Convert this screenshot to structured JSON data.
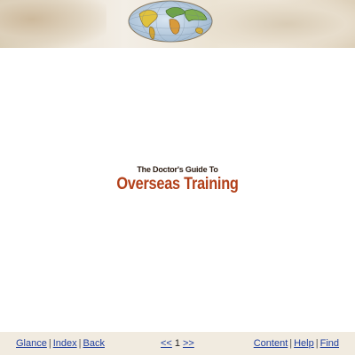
{
  "header": {
    "banner_icon": "globe-icon"
  },
  "title": {
    "subtitle": "The Doctor's  Guide To",
    "main": "Overseas Training"
  },
  "footer": {
    "left_links": [
      "Glance",
      "Index",
      "Back"
    ],
    "prev_label": "<<",
    "page_number": "1",
    "next_label": ">>",
    "right_links": [
      "Content",
      "Help",
      "Find"
    ],
    "separator": "|"
  },
  "colors": {
    "title_accent": "#b2401a",
    "link": "#1f3f9e",
    "footer_bg": "#f1ebe0"
  }
}
